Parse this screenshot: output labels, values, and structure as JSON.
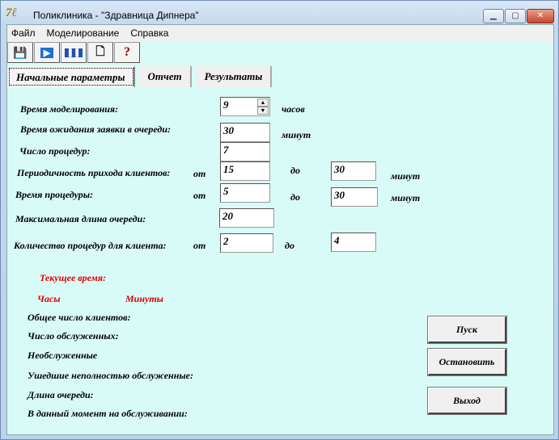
{
  "window": {
    "title": "Поликлиника - \"Здравница Дипнера\"",
    "icon": "app-icon"
  },
  "menu": [
    "Файл",
    "Моделирование",
    "Справка"
  ],
  "toolbar": [
    {
      "icon": "save-icon",
      "glyph": "💾"
    },
    {
      "icon": "play-icon",
      "glyph": "▶"
    },
    {
      "icon": "pause-icon",
      "glyph": "❚❚"
    },
    {
      "icon": "new-document-icon",
      "glyph": "🗋"
    },
    {
      "icon": "help-icon",
      "glyph": "?"
    }
  ],
  "tabs": [
    "Начальные параметры",
    "Отчет",
    "Результаты"
  ],
  "params": {
    "sim_time": {
      "label": "Время моделирования:",
      "value": "9",
      "unit": "часов"
    },
    "wait_time": {
      "label": "Время ожидания заявки в очереди:",
      "value": "30",
      "unit": "минут"
    },
    "proc_count": {
      "label": "Число процедур:",
      "value": "7"
    },
    "arrival": {
      "label": "Периодичность прихода клиентов:",
      "from_label": "от",
      "from": "15",
      "to_label": "до",
      "to": "30",
      "unit": "минут"
    },
    "proc_time": {
      "label": "Время процедуры:",
      "from_label": "от",
      "from": "5",
      "to_label": "до",
      "to": "30",
      "unit": "минут"
    },
    "max_queue": {
      "label": "Максимальная длина очереди:",
      "value": "20"
    },
    "procs_per_client": {
      "label": "Количество процедур для клиента:",
      "from_label": "от",
      "from": "2",
      "to_label": "до",
      "to": "4"
    }
  },
  "status": {
    "current_time": "Текущее время:",
    "hours": "Часы",
    "minutes": "Минуты",
    "lines": [
      "Общее число клиентов:",
      "Число обслуженных:",
      "Необслуженные",
      "Ушедшие неполностью обслуженные:",
      "Длина очереди:",
      "В данный момент на обслуживании:"
    ]
  },
  "buttons": {
    "start": "Пуск",
    "stop": "Остановить",
    "exit": "Выход"
  }
}
